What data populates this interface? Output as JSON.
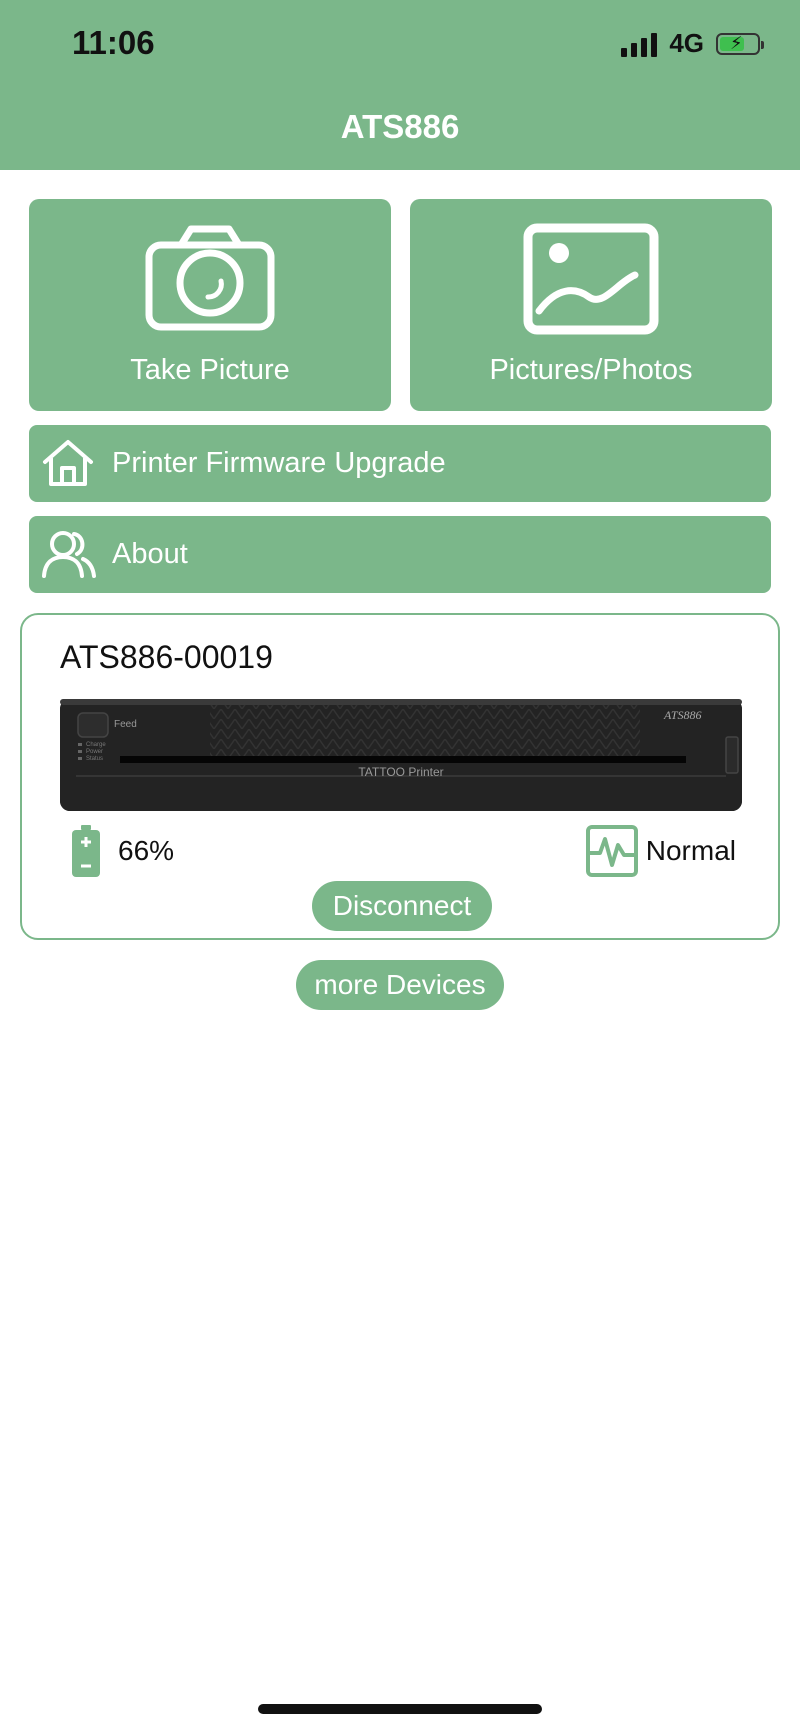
{
  "status_bar": {
    "time": "11:06",
    "network": "4G"
  },
  "header": {
    "title": "ATS886"
  },
  "tiles": [
    {
      "label": "Take Picture",
      "icon": "camera-icon"
    },
    {
      "label": "Pictures/Photos",
      "icon": "image-icon"
    }
  ],
  "menu": [
    {
      "label": "Printer Firmware Upgrade",
      "icon": "home-icon"
    },
    {
      "label": "About",
      "icon": "users-icon"
    }
  ],
  "device": {
    "name": "ATS886-00019",
    "printer_text": {
      "feed": "Feed",
      "brand": "ATS886",
      "model": "TATTOO Printer",
      "leds": [
        "Charge",
        "Power",
        "Status"
      ]
    },
    "battery": "66%",
    "status": "Normal",
    "disconnect_label": "Disconnect"
  },
  "more_devices_label": "more Devices",
  "colors": {
    "accent": "#7bb78a",
    "text": "#111111",
    "background": "#ffffff"
  }
}
